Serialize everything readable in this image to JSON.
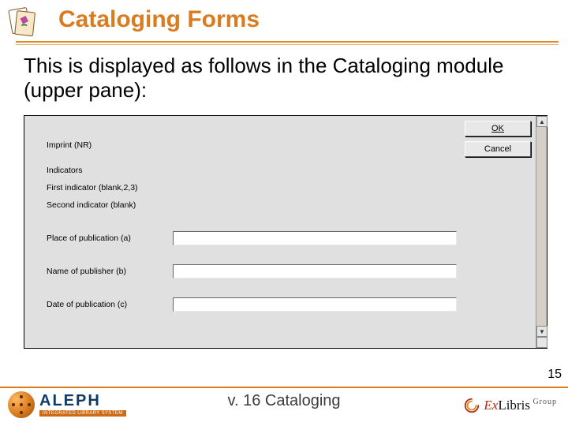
{
  "title": "Cataloging Forms",
  "intro": "This is displayed as follows in the Cataloging module (upper pane):",
  "buttons": {
    "ok": "OK",
    "cancel": "Cancel"
  },
  "form": {
    "imprint": "Imprint (NR)",
    "indicators": "Indicators",
    "ind1": "First indicator (blank,2,3)",
    "ind2": "Second indicator (blank)",
    "place": "Place of publication (a)",
    "publisher": "Name of publisher (b)",
    "date": "Date of publication (c)"
  },
  "footer": {
    "center": "v. 16 Cataloging",
    "aleph": "ALEPH",
    "aleph_sub": "INTEGRATED LIBRARY SYSTEM",
    "exl_ex": "Ex",
    "exl_libris": "Libris",
    "exl_group": " Group"
  },
  "page_num": "15"
}
